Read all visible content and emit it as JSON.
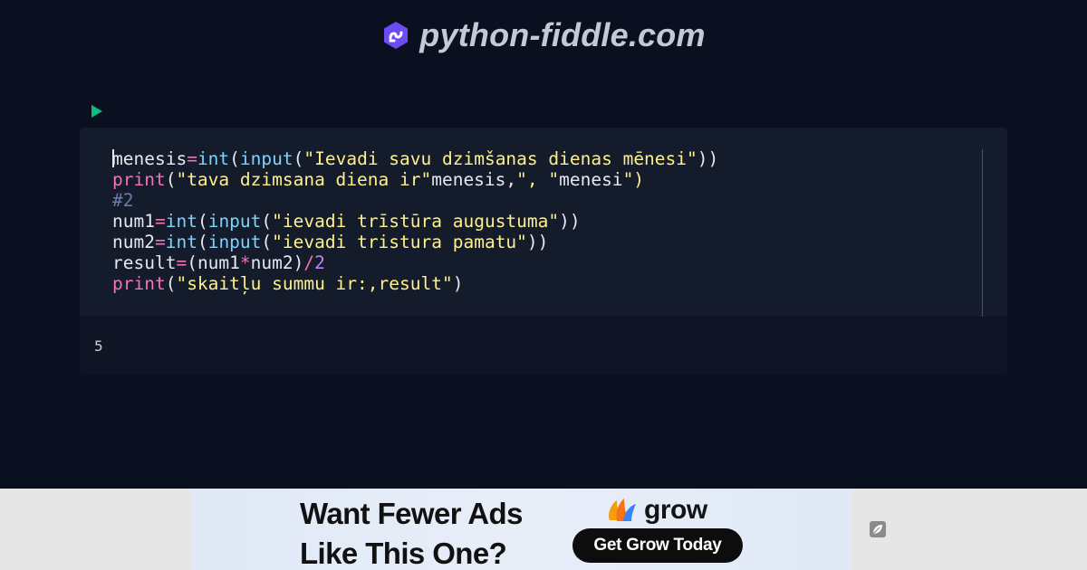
{
  "brand": {
    "name": "python-fiddle.com",
    "logo_icon": "python-fiddle-logo-icon",
    "logo_color": "#6d4cf5"
  },
  "toolbar": {
    "run_icon": "play-icon",
    "run_color": "#10b981"
  },
  "editor": {
    "lines": [
      [
        {
          "t": "menesis",
          "c": "tok-plain"
        },
        {
          "t": "=",
          "c": "tok-op"
        },
        {
          "t": "int",
          "c": "tok-builtin"
        },
        {
          "t": "(",
          "c": "tok-paren"
        },
        {
          "t": "input",
          "c": "tok-builtin"
        },
        {
          "t": "(",
          "c": "tok-paren"
        },
        {
          "t": "\"Ievadi savu dzimšanas dienas mēnesi\"",
          "c": "tok-str"
        },
        {
          "t": "))",
          "c": "tok-paren"
        }
      ],
      [
        {
          "t": "print",
          "c": "tok-fn"
        },
        {
          "t": "(",
          "c": "tok-paren"
        },
        {
          "t": "\"tava dzimsana diena ir\"",
          "c": "tok-str"
        },
        {
          "t": "menesis,",
          "c": "tok-plain"
        },
        {
          "t": "\", \"",
          "c": "tok-str"
        },
        {
          "t": "menesi",
          "c": "tok-plain"
        },
        {
          "t": "\")",
          "c": "tok-str"
        }
      ],
      [
        {
          "t": "#2",
          "c": "tok-comment"
        }
      ],
      [
        {
          "t": "num1",
          "c": "tok-plain"
        },
        {
          "t": "=",
          "c": "tok-op"
        },
        {
          "t": "int",
          "c": "tok-builtin"
        },
        {
          "t": "(",
          "c": "tok-paren"
        },
        {
          "t": "input",
          "c": "tok-builtin"
        },
        {
          "t": "(",
          "c": "tok-paren"
        },
        {
          "t": "\"ievadi trīstūra augustuma\"",
          "c": "tok-str"
        },
        {
          "t": "))",
          "c": "tok-paren"
        }
      ],
      [
        {
          "t": "num2",
          "c": "tok-plain"
        },
        {
          "t": "=",
          "c": "tok-op"
        },
        {
          "t": "int",
          "c": "tok-builtin"
        },
        {
          "t": "(",
          "c": "tok-paren"
        },
        {
          "t": "input",
          "c": "tok-builtin"
        },
        {
          "t": "(",
          "c": "tok-paren"
        },
        {
          "t": "\"ievadi tristura pamatu\"",
          "c": "tok-str"
        },
        {
          "t": "))",
          "c": "tok-paren"
        }
      ],
      [
        {
          "t": "result",
          "c": "tok-plain"
        },
        {
          "t": "=",
          "c": "tok-op"
        },
        {
          "t": "(num1",
          "c": "tok-plain"
        },
        {
          "t": "*",
          "c": "tok-op"
        },
        {
          "t": "num2)",
          "c": "tok-plain"
        },
        {
          "t": "/",
          "c": "tok-op"
        },
        {
          "t": "2",
          "c": "tok-num"
        }
      ],
      [
        {
          "t": "print",
          "c": "tok-fn"
        },
        {
          "t": "(",
          "c": "tok-paren"
        },
        {
          "t": "\"skaitļu summu ir:,result\"",
          "c": "tok-str"
        },
        {
          "t": ")",
          "c": "tok-paren"
        }
      ]
    ]
  },
  "output": {
    "text": "5"
  },
  "ad": {
    "headline_line1": "Want Fewer Ads",
    "headline_line2": "Like This One?",
    "brand_word": "grow",
    "cta_label": "Get Grow Today",
    "side_icon": "leaf-icon"
  }
}
